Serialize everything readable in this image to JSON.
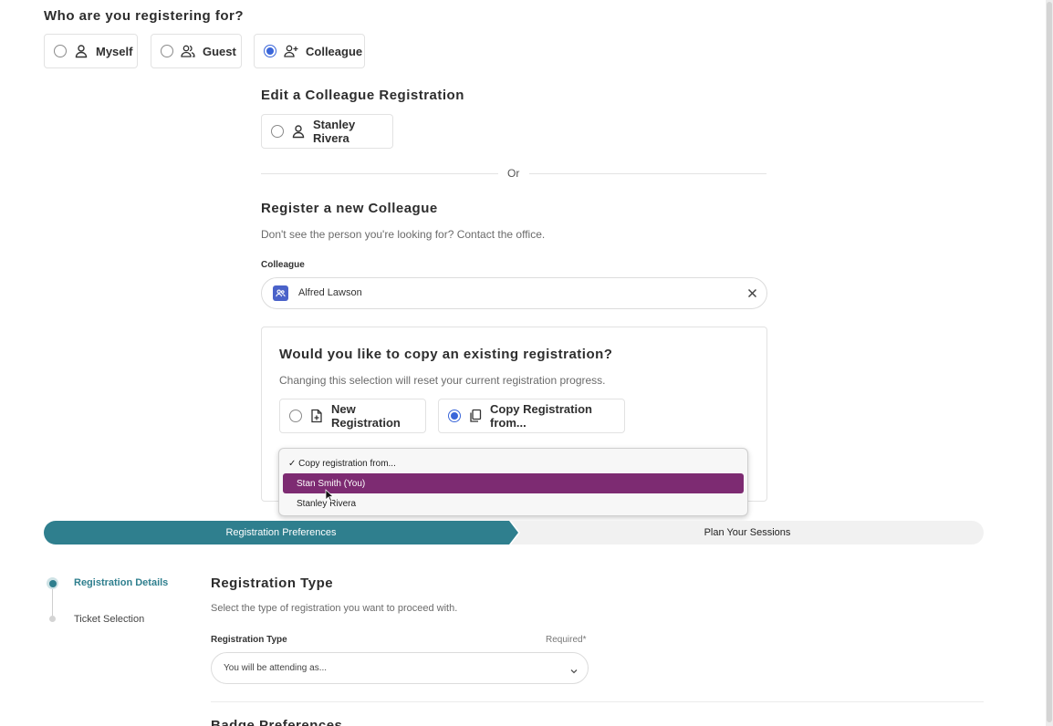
{
  "who": {
    "title": "Who are you registering for?",
    "options": [
      "Myself",
      "Guest",
      "Colleague"
    ],
    "selected": "Colleague"
  },
  "edit": {
    "title": "Edit a Colleague Registration",
    "option": "Stanley Rivera"
  },
  "divider_text": "Or",
  "register_new": {
    "title": "Register a new Colleague",
    "hint": "Don't see the person you're looking for? Contact the office.",
    "field_label": "Colleague",
    "field_value": "Alfred Lawson"
  },
  "copy_panel": {
    "title": "Would you like to copy an existing registration?",
    "hint": "Changing this selection will reset your current registration progress.",
    "option_new": "New Registration",
    "option_copy": "Copy Registration from...",
    "selected": "Copy Registration from..."
  },
  "dropdown": {
    "header": "✓ Copy registration from...",
    "items": [
      "Stan Smith (You)",
      "Stanley Rivera"
    ],
    "highlighted": "Stan Smith (You)"
  },
  "progress": {
    "step1": "Registration Preferences",
    "step2": "Plan Your Sessions"
  },
  "side_steps": [
    "Registration Details",
    "Ticket Selection"
  ],
  "reg_type": {
    "title": "Registration Type",
    "hint": "Select the type of registration you want to proceed with.",
    "field_label": "Registration Type",
    "required": "Required*",
    "placeholder": "You will be attending as..."
  },
  "next_section_partial": "Badge Preferences",
  "colors": {
    "accent_blue": "#3a66d9",
    "progress_teal": "#2f7f8e",
    "highlight_purple": "#7d2b72"
  }
}
